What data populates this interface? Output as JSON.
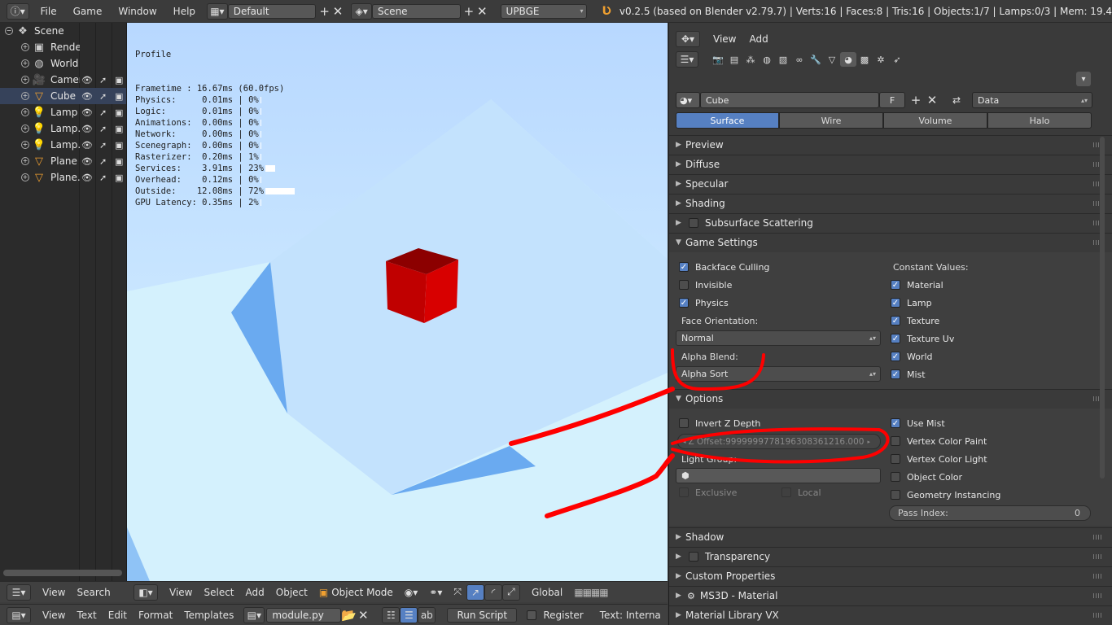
{
  "topbar": {
    "menus": [
      "File",
      "Game",
      "Window",
      "Help"
    ],
    "screen_layout": "Default",
    "scene": "Scene",
    "engine": "UPBGE",
    "info": "v0.2.5 (based on Blender v2.79.7)  | Verts:16 | Faces:8 | Tris:16 | Objects:1/7 | Lamps:0/3 | Mem: 19.4"
  },
  "outliner": {
    "items": [
      {
        "label": "Scene",
        "icon": "scene-icon",
        "glyph": "❖"
      },
      {
        "label": "Render",
        "icon": "render-icon",
        "glyph": "▣"
      },
      {
        "label": "World",
        "icon": "world-icon",
        "glyph": "◍"
      },
      {
        "label": "Camer",
        "icon": "camera-icon",
        "glyph": "🎥"
      },
      {
        "label": "Cube",
        "icon": "mesh-icon",
        "glyph": "▽"
      },
      {
        "label": "Lamp",
        "icon": "lamp-icon",
        "glyph": "💡"
      },
      {
        "label": "Lamp.(",
        "icon": "lamp-icon",
        "glyph": "💡"
      },
      {
        "label": "Lamp.(",
        "icon": "lamp-icon",
        "glyph": "💡"
      },
      {
        "label": "Plane",
        "icon": "mesh-icon",
        "glyph": "▽"
      },
      {
        "label": "Plane.(",
        "icon": "mesh-icon",
        "glyph": "▽"
      }
    ]
  },
  "profile": {
    "title": "Profile",
    "lines": [
      {
        "text": "Frametime : 16.67ms (60.0fps)",
        "bar": 0
      },
      {
        "text": "Physics:     0.01ms | 0%",
        "bar": 0.01
      },
      {
        "text": "Logic:       0.01ms | 0%",
        "bar": 0.01
      },
      {
        "text": "Animations:  0.00ms | 0%",
        "bar": 0.01
      },
      {
        "text": "Network:     0.00ms | 0%",
        "bar": 0.01
      },
      {
        "text": "Scenegraph:  0.00ms | 0%",
        "bar": 0.01
      },
      {
        "text": "Rasterizer:  0.20ms | 1%",
        "bar": 0.01
      },
      {
        "text": "Services:    3.91ms | 23%",
        "bar": 0.23
      },
      {
        "text": "Overhead:    0.12ms | 0%",
        "bar": 0.01
      },
      {
        "text": "Outside:    12.08ms | 72%",
        "bar": 0.72
      },
      {
        "text": "GPU Latency: 0.35ms | 2%",
        "bar": 0.02
      }
    ]
  },
  "props": {
    "header_menus": [
      "View",
      "Add"
    ],
    "material_name": "Cube",
    "fake_user": "F",
    "data_link": "Data",
    "tabs": [
      "Surface",
      "Wire",
      "Volume",
      "Halo"
    ],
    "panels_top": [
      "Preview",
      "Diffuse",
      "Specular",
      "Shading",
      "Subsurface Scattering",
      "Game Settings"
    ],
    "game_settings": {
      "left": [
        {
          "label": "Backface Culling",
          "checked": true
        },
        {
          "label": "Invisible",
          "checked": false
        },
        {
          "label": "Physics",
          "checked": true
        }
      ],
      "constant_values_label": "Constant Values:",
      "right": [
        {
          "label": "Material",
          "checked": true
        },
        {
          "label": "Lamp",
          "checked": true
        },
        {
          "label": "Texture",
          "checked": true
        },
        {
          "label": "Texture Uv",
          "checked": true
        },
        {
          "label": "World",
          "checked": true
        },
        {
          "label": "Mist",
          "checked": true
        }
      ],
      "face_orientation_label": "Face Orientation:",
      "face_orientation": "Normal",
      "alpha_blend_label": "Alpha Blend:",
      "alpha_blend": "Alpha Sort"
    },
    "options": {
      "title": "Options",
      "invert_z": "Invert Z Depth",
      "z_offset": "Z Offset:9999999778196308361216.000",
      "light_group_label": "Light Group:",
      "exclusive": "Exclusive",
      "local": "Local",
      "right": [
        {
          "label": "Use Mist",
          "checked": true
        },
        {
          "label": "Vertex Color Paint",
          "checked": false
        },
        {
          "label": "Vertex Color Light",
          "checked": false
        },
        {
          "label": "Object Color",
          "checked": false
        },
        {
          "label": "Geometry Instancing",
          "checked": false
        }
      ],
      "pass_index_label": "Pass Index:",
      "pass_index": "0"
    },
    "panels_bottom": [
      "Shadow",
      "Transparency",
      "Custom Properties",
      "MS3D - Material",
      "Material Library VX"
    ]
  },
  "viewport_header": {
    "menus": [
      "View",
      "Select",
      "Add",
      "Object"
    ],
    "mode": "Object Mode",
    "orientation": "Global"
  },
  "outliner_header": {
    "menus": [
      "View",
      "Search"
    ]
  },
  "text_header": {
    "menus": [
      "View",
      "Text",
      "Edit",
      "Format",
      "Templates"
    ],
    "file": "module.py",
    "run_script": "Run Script",
    "register": "Register",
    "text_status": "Text: Interna"
  },
  "colors": {
    "accent": "#5680c2",
    "annotation": "#ff0000",
    "cube": "#cc0000"
  }
}
